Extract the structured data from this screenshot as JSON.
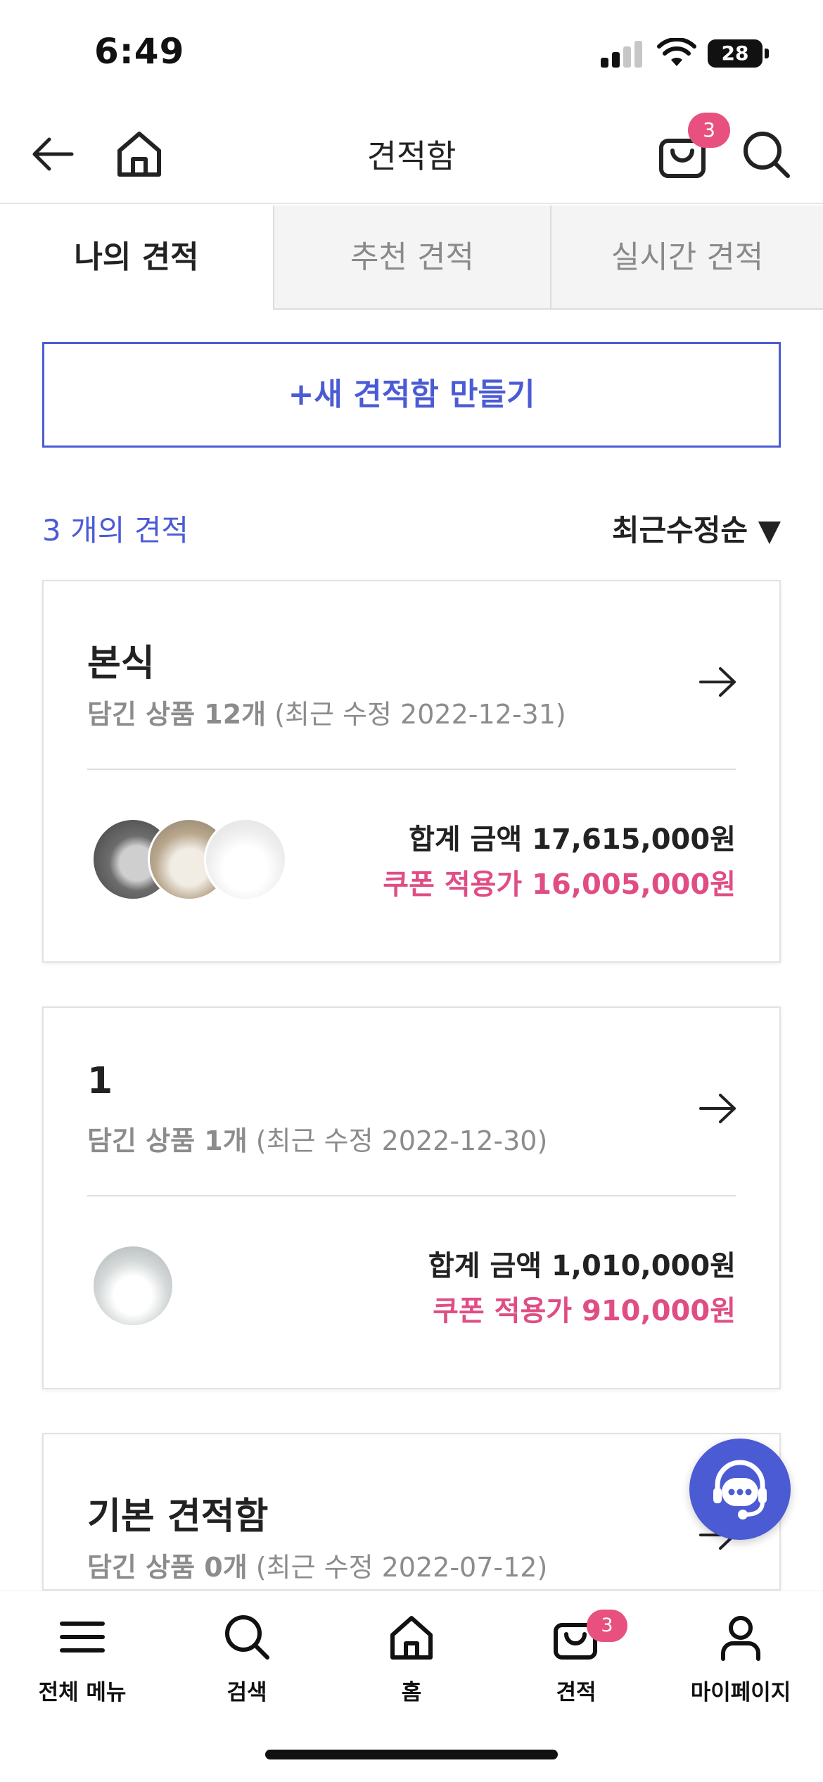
{
  "status_bar": {
    "time": "6:49",
    "battery": "28"
  },
  "header": {
    "title": "견적함",
    "cart_badge": "3"
  },
  "tabs": [
    {
      "label": "나의 견적",
      "active": true
    },
    {
      "label": "추천 견적",
      "active": false
    },
    {
      "label": "실시간 견적",
      "active": false
    }
  ],
  "new_button": {
    "label": "+새 견적함 만들기"
  },
  "list_header": {
    "count_text": "3 개의 견적",
    "sort_label": "최근수정순 ▼"
  },
  "cards": [
    {
      "title": "본식",
      "items_label": "담긴 상품 12개",
      "modified": "(최근 수정 2022-12-31)",
      "total": "합계 금액 17,615,000원",
      "coupon": "쿠폰 적용가 16,005,000원"
    },
    {
      "title": "1",
      "items_label": "담긴 상품 1개",
      "modified": "(최근 수정 2022-12-30)",
      "total": "합계 금액 1,010,000원",
      "coupon": "쿠폰 적용가 910,000원"
    },
    {
      "title": "기본 견적함",
      "items_label": "담긴 상품 0개",
      "modified": "(최근 수정 2022-07-12)",
      "total": "",
      "coupon": ""
    }
  ],
  "bottom_nav": [
    {
      "label": "전체 메뉴",
      "icon": "menu-icon"
    },
    {
      "label": "검색",
      "icon": "search-icon"
    },
    {
      "label": "홈",
      "icon": "home-icon"
    },
    {
      "label": "견적",
      "icon": "cart-icon",
      "badge": "3"
    },
    {
      "label": "마이페이지",
      "icon": "person-icon"
    }
  ],
  "colors": {
    "accent": "#4b5bd4",
    "badge": "#e8517f",
    "coupon": "#e04d84"
  }
}
